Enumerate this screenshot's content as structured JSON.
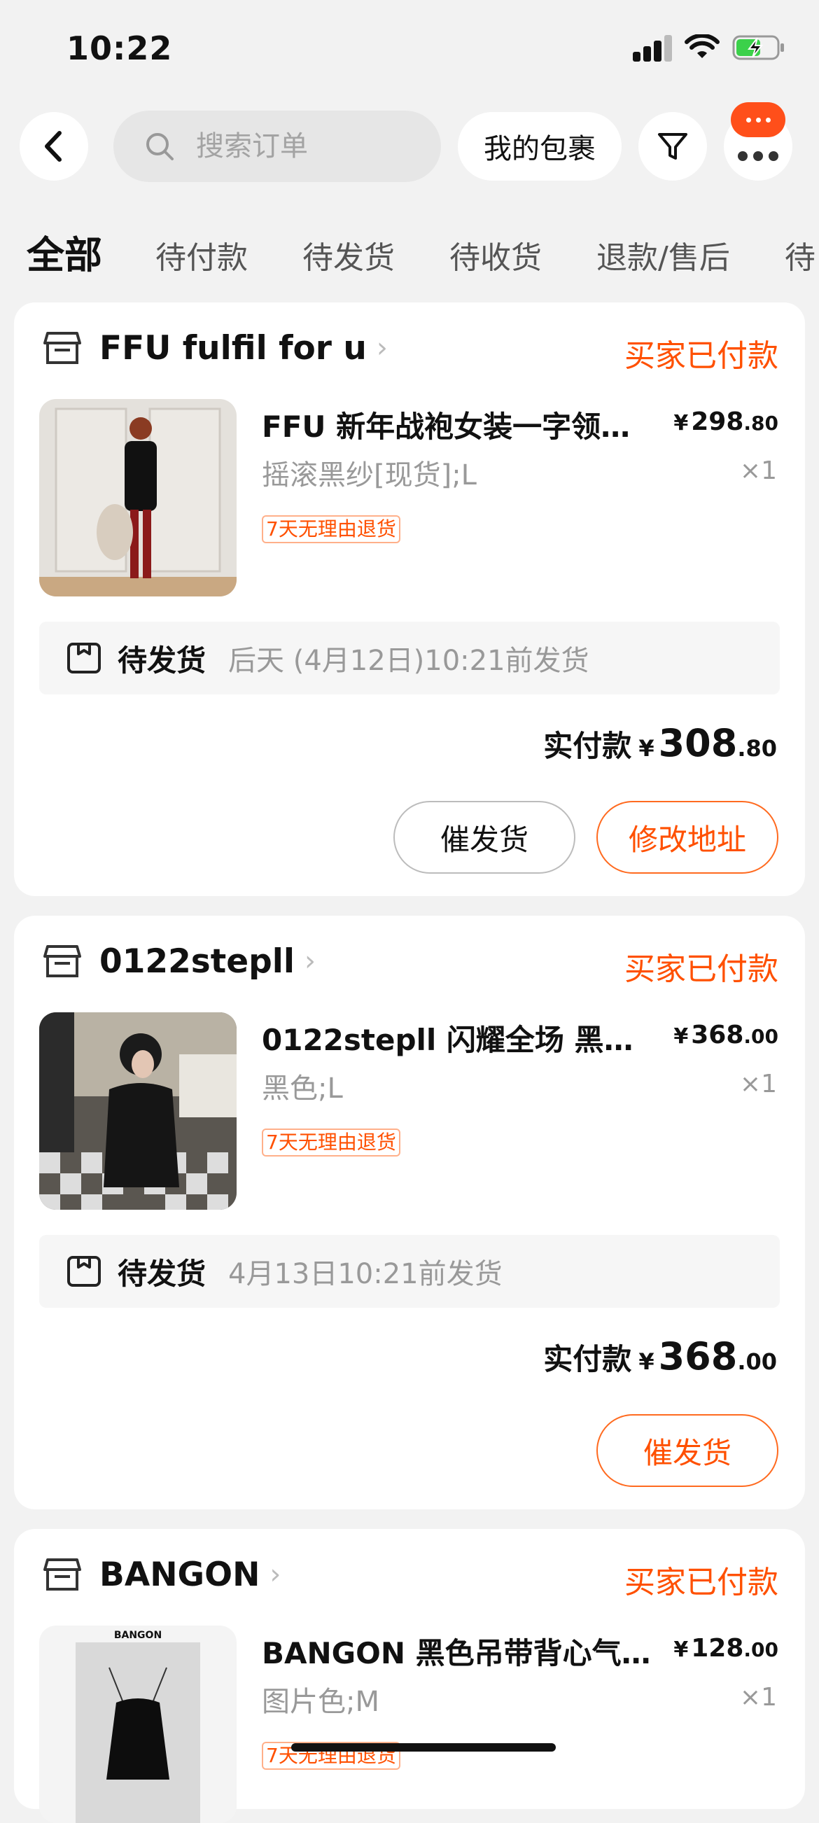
{
  "status_bar": {
    "time": "10:22"
  },
  "nav": {
    "search_placeholder": "搜索订单",
    "my_packages_label": "我的包裹"
  },
  "tabs": [
    "全部",
    "待付款",
    "待发货",
    "待收货",
    "退款/售后",
    "待"
  ],
  "orders": [
    {
      "shop_name": "FFU fulfil for u",
      "status": "买家已付款",
      "title": "FFU 新年战袍女装一字领…",
      "price_int": "298",
      "price_dec": ".80",
      "spec": "摇滚黑纱[现货];L",
      "qty": "×1",
      "tag": "7天无理由退货",
      "ship_status": "待发货",
      "ship_time": "后天 (4月12日)10:21前发货",
      "paid_label": "实付款",
      "paid_int": "308",
      "paid_dec": ".80",
      "buttons": [
        "催发货",
        "修改地址"
      ]
    },
    {
      "shop_name": "0122stepll",
      "status": "买家已付款",
      "title": "0122stepll 闪耀全场 黑色…",
      "price_int": "368",
      "price_dec": ".00",
      "spec": "黑色;L",
      "qty": "×1",
      "tag": "7天无理由退货",
      "ship_status": "待发货",
      "ship_time": "4月13日10:21前发货",
      "paid_label": "实付款",
      "paid_int": "368",
      "paid_dec": ".00",
      "buttons": [
        "催发货"
      ]
    },
    {
      "shop_name": "BANGON",
      "status": "买家已付款",
      "title": "BANGON 黑色吊带背心气…",
      "price_int": "128",
      "price_dec": ".00",
      "spec": "图片色;M",
      "qty": "×1",
      "tag": "7天无理由退货",
      "thumb_logo": "BANGON"
    }
  ],
  "currency": "¥",
  "colors": {
    "accent": "#ff5000",
    "background": "#f2f2f2"
  },
  "icons": [
    "back-icon",
    "search-icon",
    "filter-icon",
    "more-icon",
    "shop-icon",
    "chevron-right-icon",
    "package-icon"
  ]
}
